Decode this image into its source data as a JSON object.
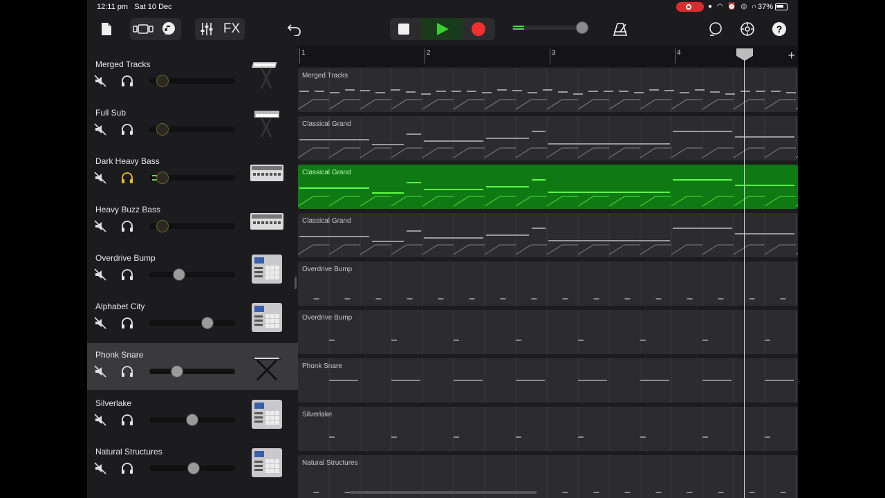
{
  "status_bar": {
    "time": "12:11 pm",
    "date": "Sat 10 Dec",
    "battery": "37%"
  },
  "toolbar": {
    "fx_label": "FX",
    "buttons": [
      "my-songs-icon",
      "view-toggle-icon",
      "loops-icon",
      "mixer-icon",
      "undo-icon",
      "stop-icon",
      "play-icon",
      "record-icon",
      "metronome-icon",
      "loop-icon",
      "settings-icon",
      "help-icon"
    ]
  },
  "ruler": {
    "bars": [
      "1",
      "2",
      "3",
      "4"
    ],
    "add_label": "+"
  },
  "tracks": [
    {
      "name": "Merged Tracks",
      "solo_active": false,
      "volume": 0.15,
      "instrument": "keyboard-stand"
    },
    {
      "name": "Full Sub",
      "solo_active": false,
      "volume": 0.15,
      "instrument": "synth-stand"
    },
    {
      "name": "Dark Heavy Bass",
      "solo_active": true,
      "volume": 0.15,
      "instrument": "drum-machine-white"
    },
    {
      "name": "Heavy Buzz Bass",
      "solo_active": false,
      "volume": 0.15,
      "instrument": "drum-machine-white"
    },
    {
      "name": "Overdrive Bump",
      "solo_active": false,
      "volume": 0.35,
      "instrument": "mpc-sampler"
    },
    {
      "name": "Alphabet City",
      "solo_active": false,
      "volume": 0.68,
      "instrument": "mpc-sampler"
    },
    {
      "name": "Phonk Snare",
      "solo_active": false,
      "volume": 0.32,
      "instrument": "x-stand-keyboard",
      "selected": true
    },
    {
      "name": "Silverlake",
      "solo_active": false,
      "volume": 0.5,
      "instrument": "mpc-sampler"
    },
    {
      "name": "Natural Structures",
      "solo_active": false,
      "volume": 0.52,
      "instrument": "mpc-sampler"
    }
  ],
  "regions": [
    {
      "name": "Merged Tracks",
      "style": "notes-dense"
    },
    {
      "name": "Classical Grand",
      "style": "notes-bass"
    },
    {
      "name": "Classical Grand",
      "style": "notes-bass",
      "highlighted": true
    },
    {
      "name": "Classical Grand",
      "style": "notes-bass"
    },
    {
      "name": "Overdrive Bump",
      "style": "dashes"
    },
    {
      "name": "Overdrive Bump",
      "style": "dashes-sparse"
    },
    {
      "name": "Phonk Snare",
      "style": "lines"
    },
    {
      "name": "Silverlake",
      "style": "dashes-sparse"
    },
    {
      "name": "Natural Structures",
      "style": "dashes"
    }
  ],
  "colors": {
    "accent_green": "#39d130",
    "region_green": "#0f7a13",
    "record_red": "#f1302d"
  }
}
